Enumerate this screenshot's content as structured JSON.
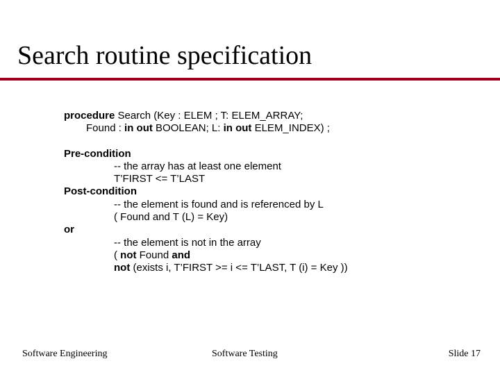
{
  "title": "Search routine specification",
  "signature": {
    "line1_pre": "procedure",
    "line1_rest": " Search (Key : ELEM ; T: ELEM_ARRAY;",
    "line2_a": "Found : ",
    "line2_b": "in out",
    "line2_c": " BOOLEAN; L: ",
    "line2_d": "in out",
    "line2_e": " ELEM_INDEX) ;"
  },
  "pre_label": "Pre-condition",
  "pre_comment": "-- the array has at least one element",
  "pre_expr": "T’FIRST <= T’LAST",
  "post_label": "Post-condition",
  "post_a_comment": "-- the element is found and is referenced by L",
  "post_a_expr": "( Found and T (L) = Key)",
  "or": "or",
  "post_b_comment": "-- the element is not in the array",
  "post_b_expr_a": "( ",
  "post_b_expr_b": "not",
  "post_b_expr_c": " Found ",
  "post_b_expr_d": "and",
  "post_c_expr_a": "not",
  "post_c_expr_b": " (exists i, T’FIRST >= i <= T’LAST, T (i) = Key ))",
  "footer": {
    "left": "Software Engineering",
    "mid": "Software Testing",
    "right": "Slide 17"
  }
}
